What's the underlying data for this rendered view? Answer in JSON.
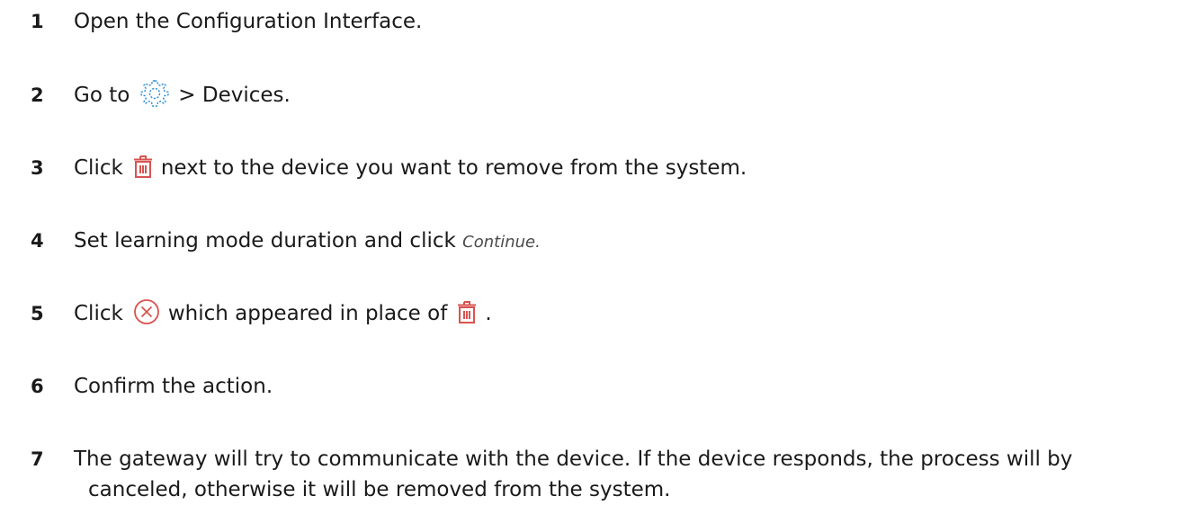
{
  "colors": {
    "text": "#1a1a1a",
    "gear_icon": "#2f8fd6",
    "trash_icon": "#d9534f",
    "cancel_icon": "#d9534f"
  },
  "steps": [
    {
      "number": "1",
      "text": "Open the Configuration Interface."
    },
    {
      "number": "2",
      "prefix": "Go to",
      "icon": "gear-icon",
      "suffix": "> Devices."
    },
    {
      "number": "3",
      "prefix": "Click",
      "icon": "trash-icon",
      "suffix": "next to the device you want to remove from the system."
    },
    {
      "number": "4",
      "prefix": "Set learning mode duration and click",
      "emphasis": "Continue."
    },
    {
      "number": "5",
      "prefix": "Click",
      "icon": "cancel-circle-icon",
      "middle": "which appeared in place of",
      "icon2": "trash-icon",
      "suffix": "."
    },
    {
      "number": "6",
      "text": "Confirm the action."
    },
    {
      "number": "7",
      "line1": "The gateway will try to communicate with the device. If the device responds, the process will by",
      "line2": "canceled, otherwise it will be removed from the system."
    }
  ]
}
